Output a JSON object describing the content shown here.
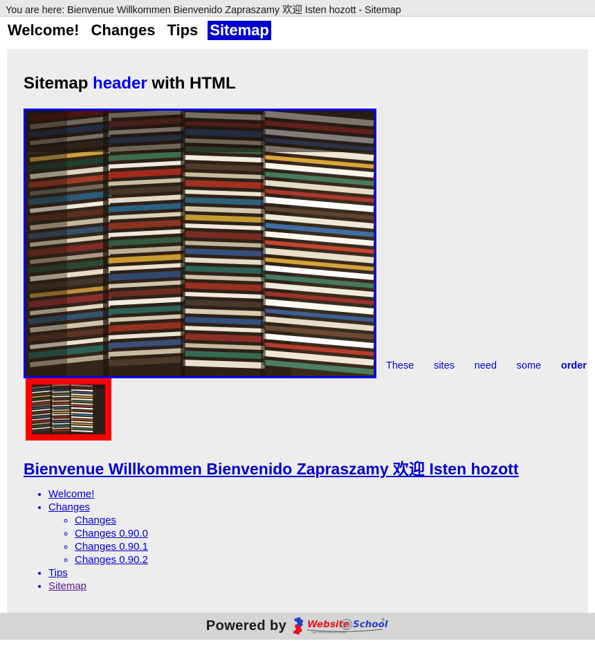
{
  "breadcrumb": {
    "prefix": "You are here:",
    "path": "Bienvenue Willkommen Bienvenido Zapraszamy 欢迎 Isten hozott - Sitemap",
    "full": "You are here: Bienvenue Willkommen Bienvenido Zapraszamy 欢迎 Isten hozott - Sitemap"
  },
  "nav": {
    "items": [
      {
        "label": "Welcome!",
        "current": false
      },
      {
        "label": "Changes",
        "current": false
      },
      {
        "label": "Tips",
        "current": false
      },
      {
        "label": "Sitemap",
        "current": true
      }
    ],
    "current_bg": "#0000cc",
    "current_fg": "#ffffff"
  },
  "page": {
    "title_part1": "Sitemap ",
    "title_highlight": "header",
    "title_part2": " with HTML",
    "highlight_color": "#0000ee"
  },
  "media": {
    "main_photo": {
      "alt": "Stacks of books piled high",
      "border_color": "#0000ee",
      "border_width": "3px"
    },
    "thumbnail": {
      "alt": "Thumbnail of stacked books",
      "border_color": "#ff0000",
      "border_width": "9px"
    }
  },
  "caption": {
    "words": [
      {
        "text": "These",
        "bold": false
      },
      {
        "text": "sites",
        "bold": false
      },
      {
        "text": "need",
        "bold": false
      },
      {
        "text": "some",
        "bold": false
      },
      {
        "text": "order",
        "bold": true
      }
    ],
    "color": "#0000cc"
  },
  "sitemap": {
    "heading": "Bienvenue Willkommen Bienvenido Zapraszamy 欢迎 Isten hozott",
    "items": [
      {
        "label": "Welcome!",
        "visited": false
      },
      {
        "label": "Changes",
        "visited": false
      },
      {
        "label": "Tips",
        "visited": false
      },
      {
        "label": "Sitemap",
        "visited": true
      }
    ],
    "sub_items": [
      {
        "label": "Changes",
        "visited": false
      },
      {
        "label": "Changes 0.90.0",
        "visited": false
      },
      {
        "label": "Changes 0.90.1",
        "visited": false
      },
      {
        "label": "Changes 0.90.2",
        "visited": false
      }
    ],
    "link_color": "#0000cc",
    "visited_color": "#551a8b"
  },
  "footer": {
    "powered_by": "Powered by",
    "brand_part1": "Website",
    "brand_at": "@",
    "brand_part2": "School",
    "brand_registered": "®",
    "tagline": "Open source cms for schools",
    "brand_red": "#e3171e",
    "brand_blue": "#2040c8"
  }
}
